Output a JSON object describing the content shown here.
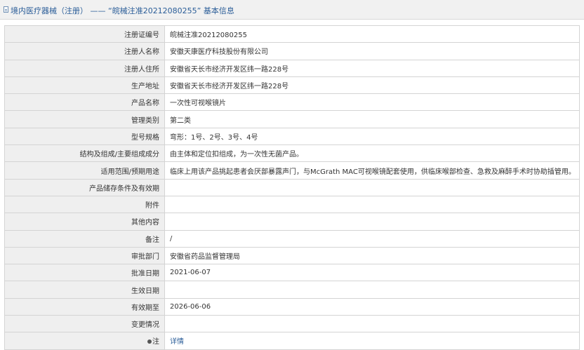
{
  "header": {
    "icon": "document-icon",
    "title": "境内医疗器械（注册） ——  “皖械注准20212080255” 基本信息"
  },
  "rows": [
    {
      "label": "注册证编号",
      "value": "皖械注准20212080255"
    },
    {
      "label": "注册人名称",
      "value": "安徽天康医疗科技股份有限公司"
    },
    {
      "label": "注册人住所",
      "value": "安徽省天长市经济开发区纬一路228号"
    },
    {
      "label": "生产地址",
      "value": "安徽省天长市经济开发区纬一路228号"
    },
    {
      "label": "产品名称",
      "value": "一次性可视喉镜片"
    },
    {
      "label": "管理类别",
      "value": "第二类"
    },
    {
      "label": "型号规格",
      "value": "弯形：1号、2号、3号、4号"
    },
    {
      "label": "结构及组成/主要组成成分",
      "value": "由主体和定位扣组成，为一次性无菌产品。"
    },
    {
      "label": "适用范围/预期用途",
      "value": "临床上用该产品挑起患者会厌部暴露声门，与McGrath MAC可视喉镜配套使用，供临床喉部检查、急救及麻醉手术时协助插管用。"
    },
    {
      "label": "产品储存条件及有效期",
      "value": ""
    },
    {
      "label": "附件",
      "value": ""
    },
    {
      "label": "其他内容",
      "value": ""
    },
    {
      "label": "备注",
      "value": "/"
    },
    {
      "label": "审批部门",
      "value": "安徽省药品监督管理局"
    },
    {
      "label": "批准日期",
      "value": "2021-06-07"
    },
    {
      "label": "生效日期",
      "value": ""
    },
    {
      "label": "有效期至",
      "value": "2026-06-06"
    },
    {
      "label": "变更情况",
      "value": ""
    }
  ],
  "note_row": {
    "icon": "pin-icon",
    "label": "注",
    "link_text": "详情"
  }
}
